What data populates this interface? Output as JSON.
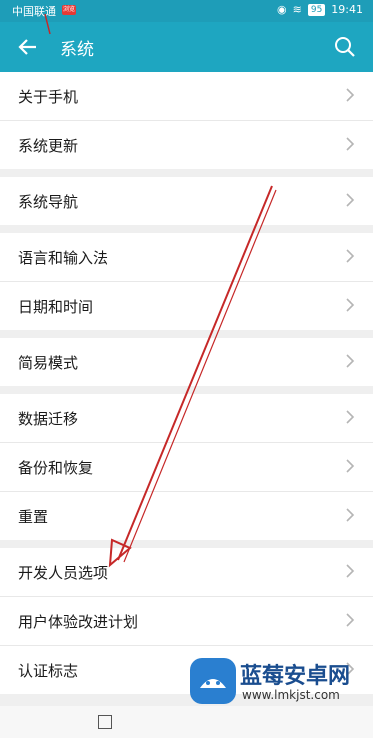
{
  "status_bar": {
    "carrier": "中国联通",
    "carrier_badge": "浏览",
    "battery": "95",
    "time": "19:41"
  },
  "header": {
    "title": "系统",
    "back_icon": "back-arrow-icon",
    "search_icon": "search-icon"
  },
  "groups": [
    {
      "items": [
        {
          "label": "关于手机"
        },
        {
          "label": "系统更新"
        }
      ]
    },
    {
      "items": [
        {
          "label": "系统导航"
        }
      ]
    },
    {
      "items": [
        {
          "label": "语言和输入法"
        },
        {
          "label": "日期和时间"
        }
      ]
    },
    {
      "items": [
        {
          "label": "简易模式"
        }
      ]
    },
    {
      "items": [
        {
          "label": "数据迁移"
        },
        {
          "label": "备份和恢复"
        },
        {
          "label": "重置"
        }
      ]
    },
    {
      "items": [
        {
          "label": "开发人员选项"
        },
        {
          "label": "用户体验改进计划"
        },
        {
          "label": "认证标志"
        }
      ]
    }
  ],
  "watermark": {
    "name": "蓝莓安卓网",
    "url": "www.lmkjst.com"
  },
  "colors": {
    "status_bar": "#1e9db8",
    "app_bar": "#1ea6c1",
    "annotation_arrow": "#c62828"
  }
}
